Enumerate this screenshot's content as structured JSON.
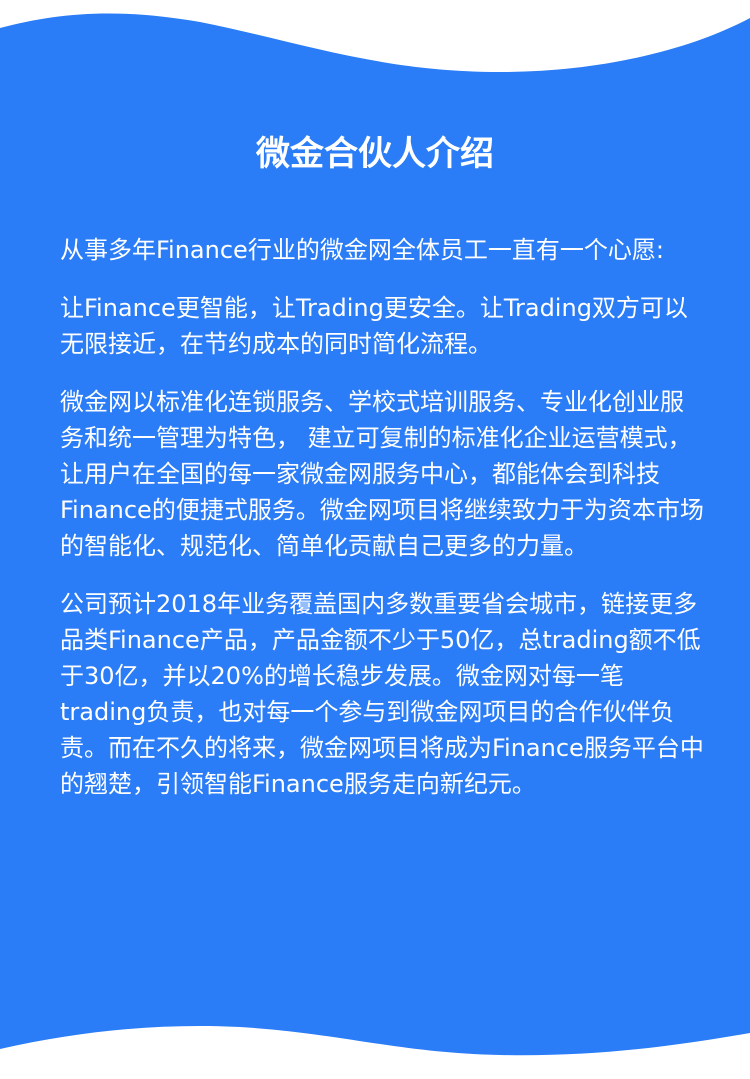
{
  "title": "微金合伙人介绍",
  "paragraphs": [
    "从事多年Finance行业的微金网全体员工一直有一个心愿:",
    "让Finance更智能，让Trading更安全。让Trading双方可以无限接近，在节约成本的同时简化流程。",
    "微金网以标准化连锁服务、学校式培训服务、专业化创业服务和统一管理为特色， 建立可复制的标准化企业运营模式，让用户在全国的每一家微金网服务中心，都能体会到科技Finance的便捷式服务。微金网项目将继续致力于为资本市场的智能化、规范化、简单化贡献自己更多的力量。",
    "公司预计2018年业务覆盖国内多数重要省会城市，链接更多品类Finance产品，产品金额不少于50亿，总trading额不低于30亿，并以20%的增长稳步发展。微金网对每一笔trading负责，也对每一个参与到微金网项目的合作伙伴负责。而在不久的将来，微金网项目将成为Finance服务平台中的翘楚，引领智能Finance服务走向新纪元。"
  ],
  "colors": {
    "background": "#2a7cf7",
    "wave": "#ffffff",
    "text": "#ffffff"
  }
}
